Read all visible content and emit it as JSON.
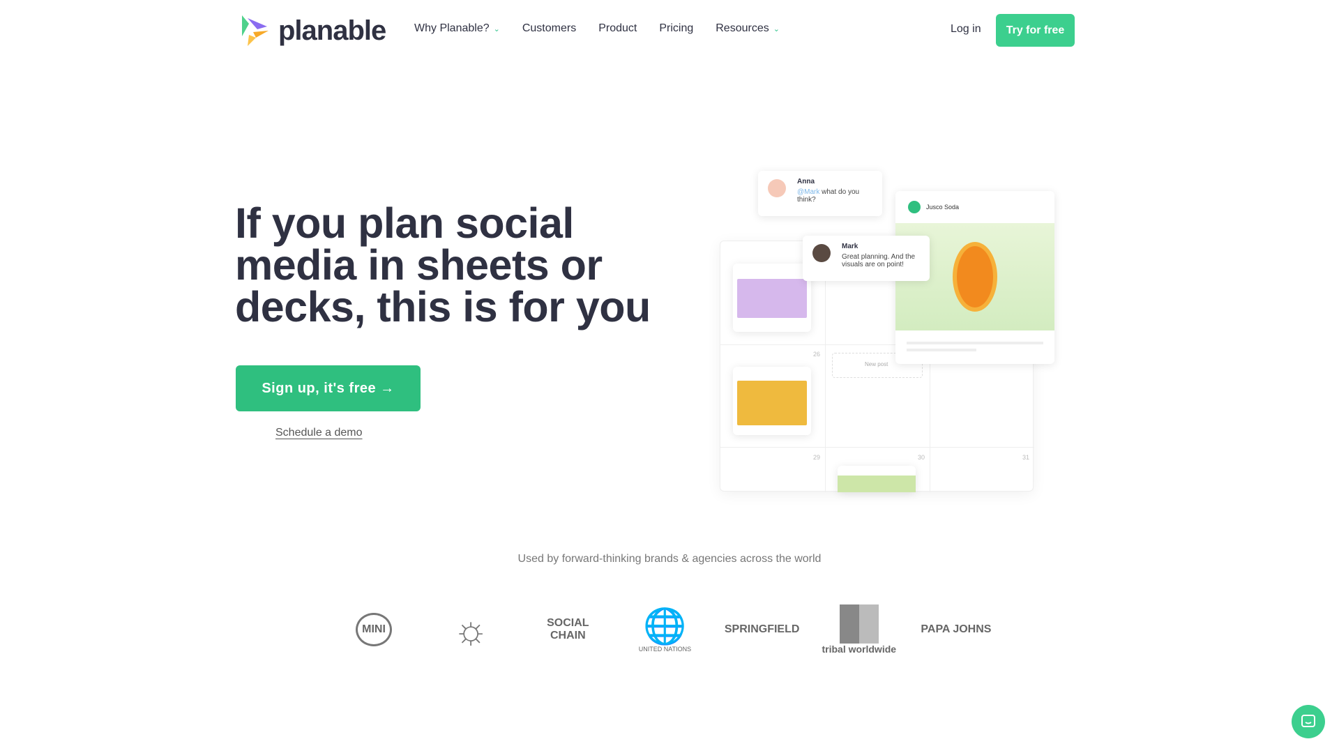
{
  "header": {
    "brand": "planable",
    "nav": [
      {
        "label": "Why Planable?",
        "dropdown": true
      },
      {
        "label": "Customers"
      },
      {
        "label": "Product"
      },
      {
        "label": "Pricing"
      },
      {
        "label": "Resources",
        "dropdown": true
      }
    ],
    "login": "Log in",
    "cta": "Try for free"
  },
  "hero": {
    "title": "If you plan social media in sheets or decks, this is for you",
    "signup": "Sign up, it's free →",
    "demo": "Schedule a demo"
  },
  "mockup": {
    "comment1": {
      "author": "Anna",
      "mention": "@Mark",
      "text": " what do you think?"
    },
    "comment2": {
      "author": "Mark",
      "text": "Great planning. And the visuals are on point!"
    },
    "page": "Jusco Soda",
    "new_post": "New post",
    "days": [
      "26",
      "29",
      "30",
      "31"
    ]
  },
  "brands": {
    "tagline": "Used by forward-thinking brands & agencies across the world",
    "logos": [
      "MINI",
      "Sun",
      "SOCIAL CHAIN",
      "UNITED NATIONS",
      "SPRINGFIELD",
      "tribal worldwide",
      "PAPA JOHNS"
    ]
  },
  "colors": {
    "accent": "#3ccf8e",
    "text": "#2f3142"
  }
}
